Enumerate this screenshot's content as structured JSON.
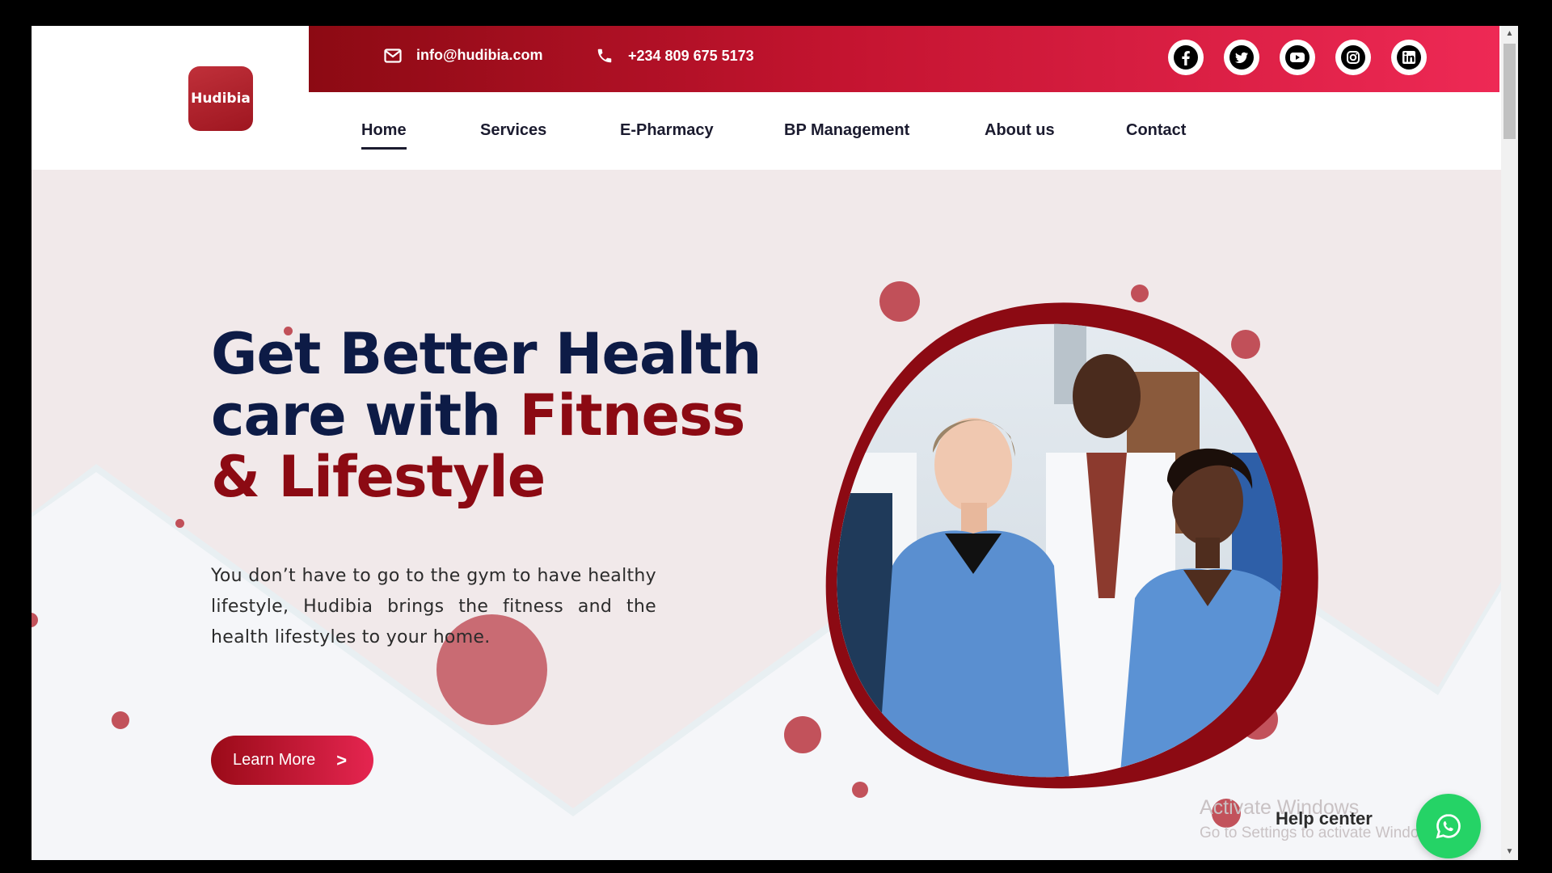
{
  "topbar": {
    "email": "info@hudibia.com",
    "phone": "+234 809 675 5173",
    "socials": [
      "facebook-icon",
      "twitter-icon",
      "youtube-icon",
      "instagram-icon",
      "linkedin-icon"
    ]
  },
  "logo": {
    "text": "Hudibia"
  },
  "nav": {
    "items": [
      {
        "label": "Home"
      },
      {
        "label": "Services"
      },
      {
        "label": "E-Pharmacy"
      },
      {
        "label": "BP Management"
      },
      {
        "label": "About us"
      },
      {
        "label": "Contact"
      }
    ],
    "active": "Home"
  },
  "hero": {
    "headline_line1": "Get Better Health",
    "headline_line2a": "care with ",
    "headline_line2b": "Fitness",
    "headline_line3": "& Lifestyle",
    "description": "You don’t have to go to the gym to have healthy lifestyle, Hudibia brings the fitness and the health lifestyles to your home.",
    "button_label": "Learn More",
    "button_icon": ">"
  },
  "watermark": {
    "line1": "Activate Windows",
    "line2": "Go to Settings to activate Windows."
  },
  "help": {
    "label": "Help center"
  },
  "colors": {
    "primary": "#8c0a13",
    "accent": "#ee2955",
    "navy": "#0d1b46",
    "whatsapp": "#25d366"
  }
}
